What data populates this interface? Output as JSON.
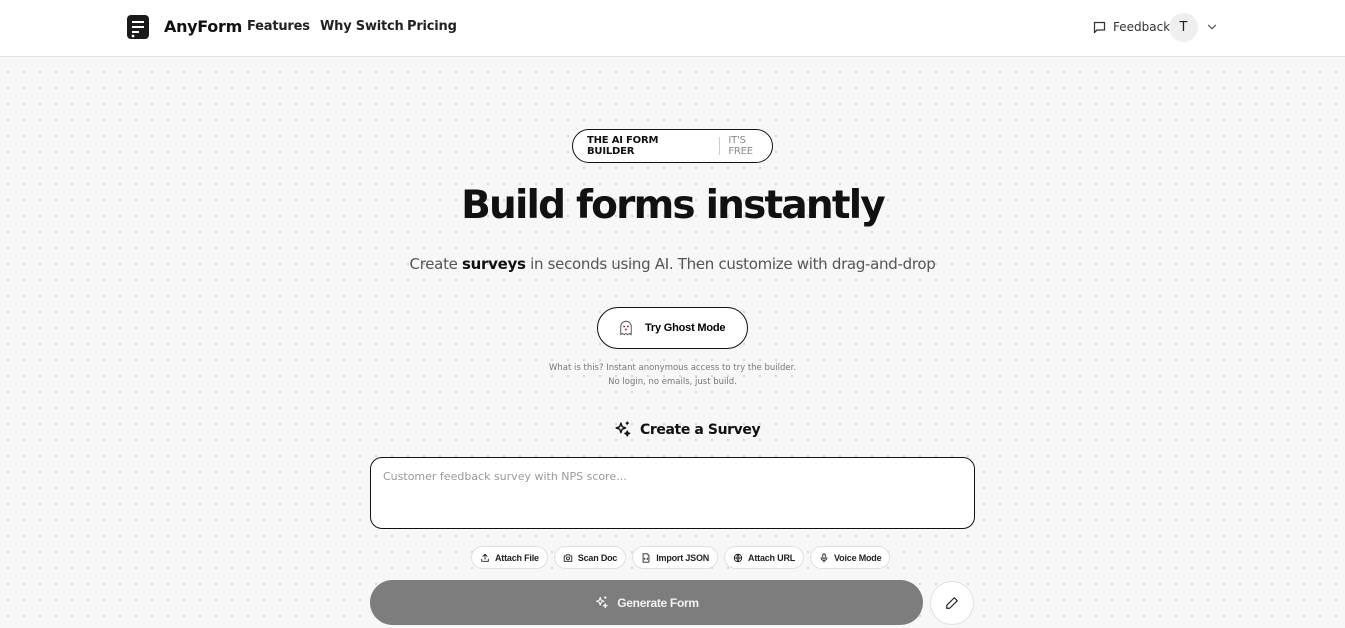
{
  "nav": {
    "brand": "AnyForm",
    "links": [
      "Features",
      "Why Switch",
      "Pricing"
    ],
    "feedback_label": "Feedback",
    "avatar_initial": "T",
    "icons": {
      "logo": "document-logo-icon",
      "feedback": "message-square-icon",
      "menu": "chevron-down-icon"
    }
  },
  "hero": {
    "badge_primary": "THE AI FORM BUILDER",
    "badge_secondary": "IT'S FREE",
    "title": "Build forms instantly",
    "subtitle_before": "Create ",
    "subtitle_highlight": "surveys",
    "subtitle_after": " in seconds using AI. Then customize with drag-and-drop"
  },
  "ghost": {
    "button_label": "Try Ghost Mode",
    "note_line1": "What is this? Instant anonymous access to try the builder.",
    "note_line2": "No login, no emails, just build."
  },
  "create": {
    "heading": "Create a Survey",
    "placeholder": "Customer feedback survey with NPS score...",
    "value": "",
    "tools": [
      {
        "label": "Attach File",
        "icon": "upload-icon"
      },
      {
        "label": "Scan Doc",
        "icon": "camera-icon"
      },
      {
        "label": "Import JSON",
        "icon": "file-code-icon"
      },
      {
        "label": "Attach URL",
        "icon": "globe-icon"
      },
      {
        "label": "Voice Mode",
        "icon": "mic-icon"
      }
    ],
    "generate_label": "Generate Form",
    "generate_enabled": false
  },
  "colors": {
    "background": "#f7f7f7",
    "accent": "#111111",
    "generate_disabled": "#7d7d7d",
    "ghost_pink": "#e0408a"
  }
}
